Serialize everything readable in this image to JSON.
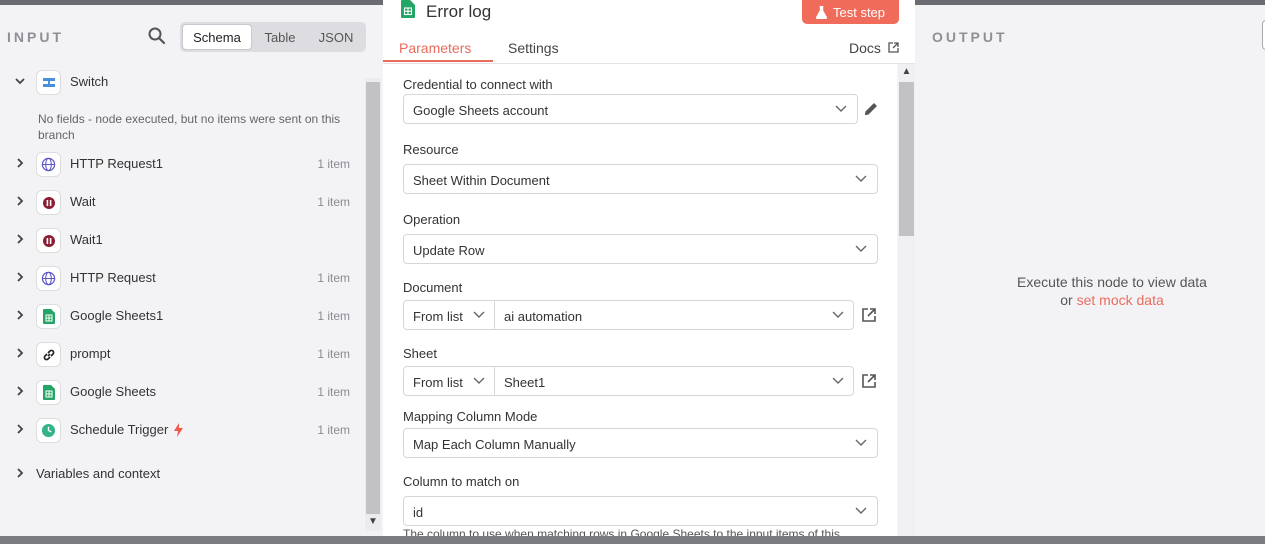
{
  "input": {
    "title": "INPUT",
    "tabs": [
      "Schema",
      "Table",
      "JSON"
    ],
    "active_tab": "Schema",
    "switch_label": "Switch",
    "no_fields_text": "No fields - node executed, but no items were sent on this branch",
    "nodes": [
      {
        "label": "HTTP Request1",
        "count": "1 item",
        "icon": "globe-icon"
      },
      {
        "label": "Wait",
        "count": "1 item",
        "icon": "pause-icon"
      },
      {
        "label": "Wait1",
        "count": "",
        "icon": "pause-icon"
      },
      {
        "label": "HTTP Request",
        "count": "1 item",
        "icon": "globe-icon"
      },
      {
        "label": "Google Sheets1",
        "count": "1 item",
        "icon": "google-sheets-icon"
      },
      {
        "label": "prompt",
        "count": "1 item",
        "icon": "link-icon"
      },
      {
        "label": "Google Sheets",
        "count": "1 item",
        "icon": "google-sheets-icon"
      },
      {
        "label": "Schedule Trigger",
        "count": "1 item",
        "icon": "clock-icon"
      }
    ],
    "variables_label": "Variables and context"
  },
  "dialog": {
    "title": "Error log",
    "test_button": "Test step",
    "tabs": {
      "parameters": "Parameters",
      "settings": "Settings"
    },
    "docs": "Docs",
    "fields": {
      "credential": {
        "label": "Credential to connect with",
        "value": "Google Sheets account"
      },
      "resource": {
        "label": "Resource",
        "value": "Sheet Within Document"
      },
      "operation": {
        "label": "Operation",
        "value": "Update Row"
      },
      "document": {
        "label": "Document",
        "mode": "From list",
        "value": "ai automation"
      },
      "sheet": {
        "label": "Sheet",
        "mode": "From list",
        "value": "Sheet1"
      },
      "mapping": {
        "label": "Mapping Column Mode",
        "value": "Map Each Column Manually"
      },
      "match_column": {
        "label": "Column to match on",
        "value": "id"
      }
    },
    "hint": "The column to use when matching rows in Google Sheets to the input items of this"
  },
  "output": {
    "title": "OUTPUT",
    "empty_text": "Execute this node to view data",
    "or_text": "or",
    "mock_link": "set mock data"
  },
  "colors": {
    "accent": "#ea6c5d",
    "sheets_green": "#23a566"
  }
}
